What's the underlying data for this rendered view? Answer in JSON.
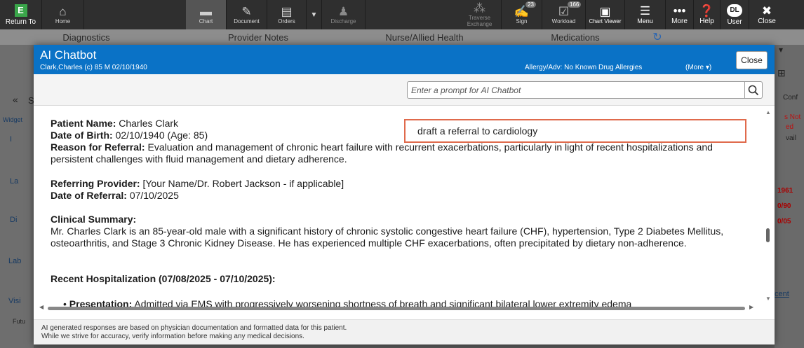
{
  "toolbar": {
    "return_label": "Return To",
    "return_icon": "E",
    "home": "Home",
    "chart": "Chart",
    "document": "Document",
    "orders": "Orders",
    "discharge": "Discharge",
    "traverse": "Traverse Exchange",
    "sign": "Sign",
    "sign_count": "23",
    "workload": "Workload",
    "workload_count": "166",
    "chart_viewer": "Chart Viewer",
    "menu": "Menu",
    "more": "More",
    "help": "Help",
    "user_initials": "DL",
    "user": "User",
    "close": "Close"
  },
  "tabs": [
    "Diagnostics",
    "Provider Notes",
    "Nurse/Allied Health",
    "Medications"
  ],
  "background": {
    "left_rows": [
      "S",
      "Widget",
      "I",
      "La",
      "Di",
      "Lab",
      "Visi",
      "Futu"
    ],
    "right_rows": [
      "Conf",
      "s Not",
      "ed",
      "vail",
      "1961",
      "0/90",
      "0/05",
      "cent"
    ]
  },
  "modal": {
    "title": "AI Chatbot",
    "patient": "Clark,Charles (c)  85  M  02/10/1940",
    "allergy": "Allergy/Adv: No Known Drug Allergies",
    "more": "(More ▾)",
    "close": "Close",
    "prompt_placeholder": "Enter a prompt for AI Chatbot",
    "user_message": "draft a referral to cardiology",
    "referral": {
      "patient_name_label": "Patient Name:",
      "patient_name": "Charles Clark",
      "dob_label": "Date of Birth:",
      "dob": "02/10/1940 (Age: 85)",
      "reason_label": "Reason for Referral:",
      "reason": "Evaluation and management of chronic heart failure with recurrent exacerbations, particularly in light of recent hospitalizations and persistent challenges with fluid management and dietary adherence.",
      "provider_label": "Referring Provider:",
      "provider": "[Your Name/Dr. Robert Jackson - if applicable]",
      "date_label": "Date of Referral:",
      "date": "07/10/2025",
      "summary_heading": "Clinical Summary:",
      "summary": "Mr. Charles Clark is an 85-year-old male with a significant history of chronic systolic congestive heart failure (CHF), hypertension, Type 2 Diabetes Mellitus, osteoarthritis, and Stage 3 Chronic Kidney Disease. He has experienced multiple CHF exacerbations, often precipitated by dietary non-adherence.",
      "hosp_heading": "Recent Hospitalization (07/08/2025 - 07/10/2025):",
      "presentation_label": "Presentation:",
      "presentation": "Admitted via EMS with progressively worsening shortness of breath and significant bilateral lower extremity edema"
    },
    "footer_line1": "AI generated responses are based on physician documentation and formatted data for this patient.",
    "footer_line2": "While we strive for accuracy, verify information before making any medical decisions."
  }
}
